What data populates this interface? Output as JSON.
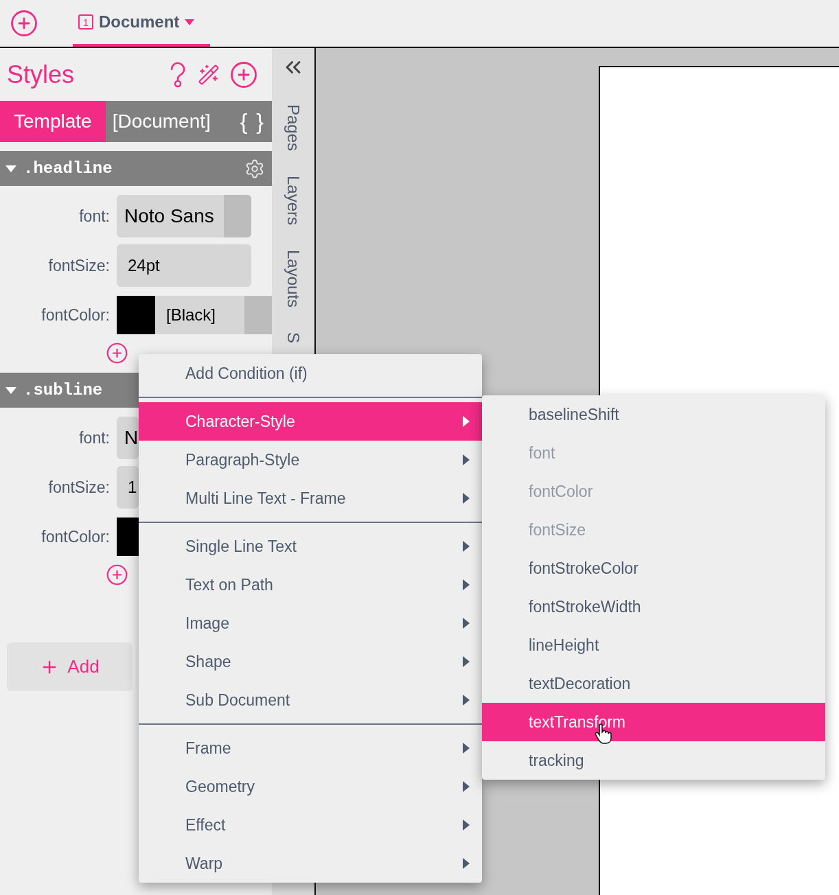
{
  "top_bar": {
    "tab": {
      "badge": "1",
      "label": "Document",
      "selected": true
    }
  },
  "styles_panel": {
    "title": "Styles",
    "tabs": [
      {
        "label": "Template",
        "selected": true
      },
      {
        "label": "[Document]",
        "selected": false
      }
    ],
    "braces": "{ }",
    "sections": [
      {
        "name": ".headline",
        "expanded": true,
        "covered": false,
        "fields": [
          {
            "label": "font:",
            "kind": "select",
            "value": "Noto Sans"
          },
          {
            "label": "fontSize:",
            "kind": "text",
            "value": "24pt"
          },
          {
            "label": "fontColor:",
            "kind": "color",
            "color": "#000000",
            "value": "[Black]"
          }
        ]
      },
      {
        "name": ".subline",
        "expanded": true,
        "covered": true,
        "fields": [
          {
            "label": "font:",
            "kind": "select",
            "value": "N"
          },
          {
            "label": "fontSize:",
            "kind": "text",
            "value": "1"
          },
          {
            "label": "fontColor:",
            "kind": "color",
            "color": "#000000"
          }
        ]
      }
    ],
    "add_button": "Add"
  },
  "side_tabs": [
    "Pages",
    "Layers",
    "Layouts",
    "S"
  ],
  "context_menu": {
    "groups": [
      [
        {
          "label": "Add Condition (if)",
          "submenu": false,
          "selected": false
        }
      ],
      [
        {
          "label": "Character-Style",
          "submenu": true,
          "selected": true
        },
        {
          "label": "Paragraph-Style",
          "submenu": true,
          "selected": false
        },
        {
          "label": "Multi Line Text - Frame",
          "submenu": true,
          "selected": false
        }
      ],
      [
        {
          "label": "Single Line Text",
          "submenu": true,
          "selected": false
        },
        {
          "label": "Text on Path",
          "submenu": true,
          "selected": false
        },
        {
          "label": "Image",
          "submenu": true,
          "selected": false
        },
        {
          "label": "Shape",
          "submenu": true,
          "selected": false
        },
        {
          "label": "Sub Document",
          "submenu": true,
          "selected": false
        }
      ],
      [
        {
          "label": "Frame",
          "submenu": true,
          "selected": false
        },
        {
          "label": "Geometry",
          "submenu": true,
          "selected": false
        },
        {
          "label": "Effect",
          "submenu": true,
          "selected": false
        },
        {
          "label": "Warp",
          "submenu": true,
          "selected": false
        }
      ]
    ]
  },
  "submenu": {
    "items": [
      {
        "label": "baselineShift",
        "disabled": false,
        "selected": false
      },
      {
        "label": "font",
        "disabled": true,
        "selected": false
      },
      {
        "label": "fontColor",
        "disabled": true,
        "selected": false
      },
      {
        "label": "fontSize",
        "disabled": true,
        "selected": false
      },
      {
        "label": "fontStrokeColor",
        "disabled": false,
        "selected": false
      },
      {
        "label": "fontStrokeWidth",
        "disabled": false,
        "selected": false
      },
      {
        "label": "lineHeight",
        "disabled": false,
        "selected": false
      },
      {
        "label": "textDecoration",
        "disabled": false,
        "selected": false
      },
      {
        "label": "textTransform",
        "disabled": false,
        "selected": true
      },
      {
        "label": "tracking",
        "disabled": false,
        "selected": false
      }
    ]
  }
}
